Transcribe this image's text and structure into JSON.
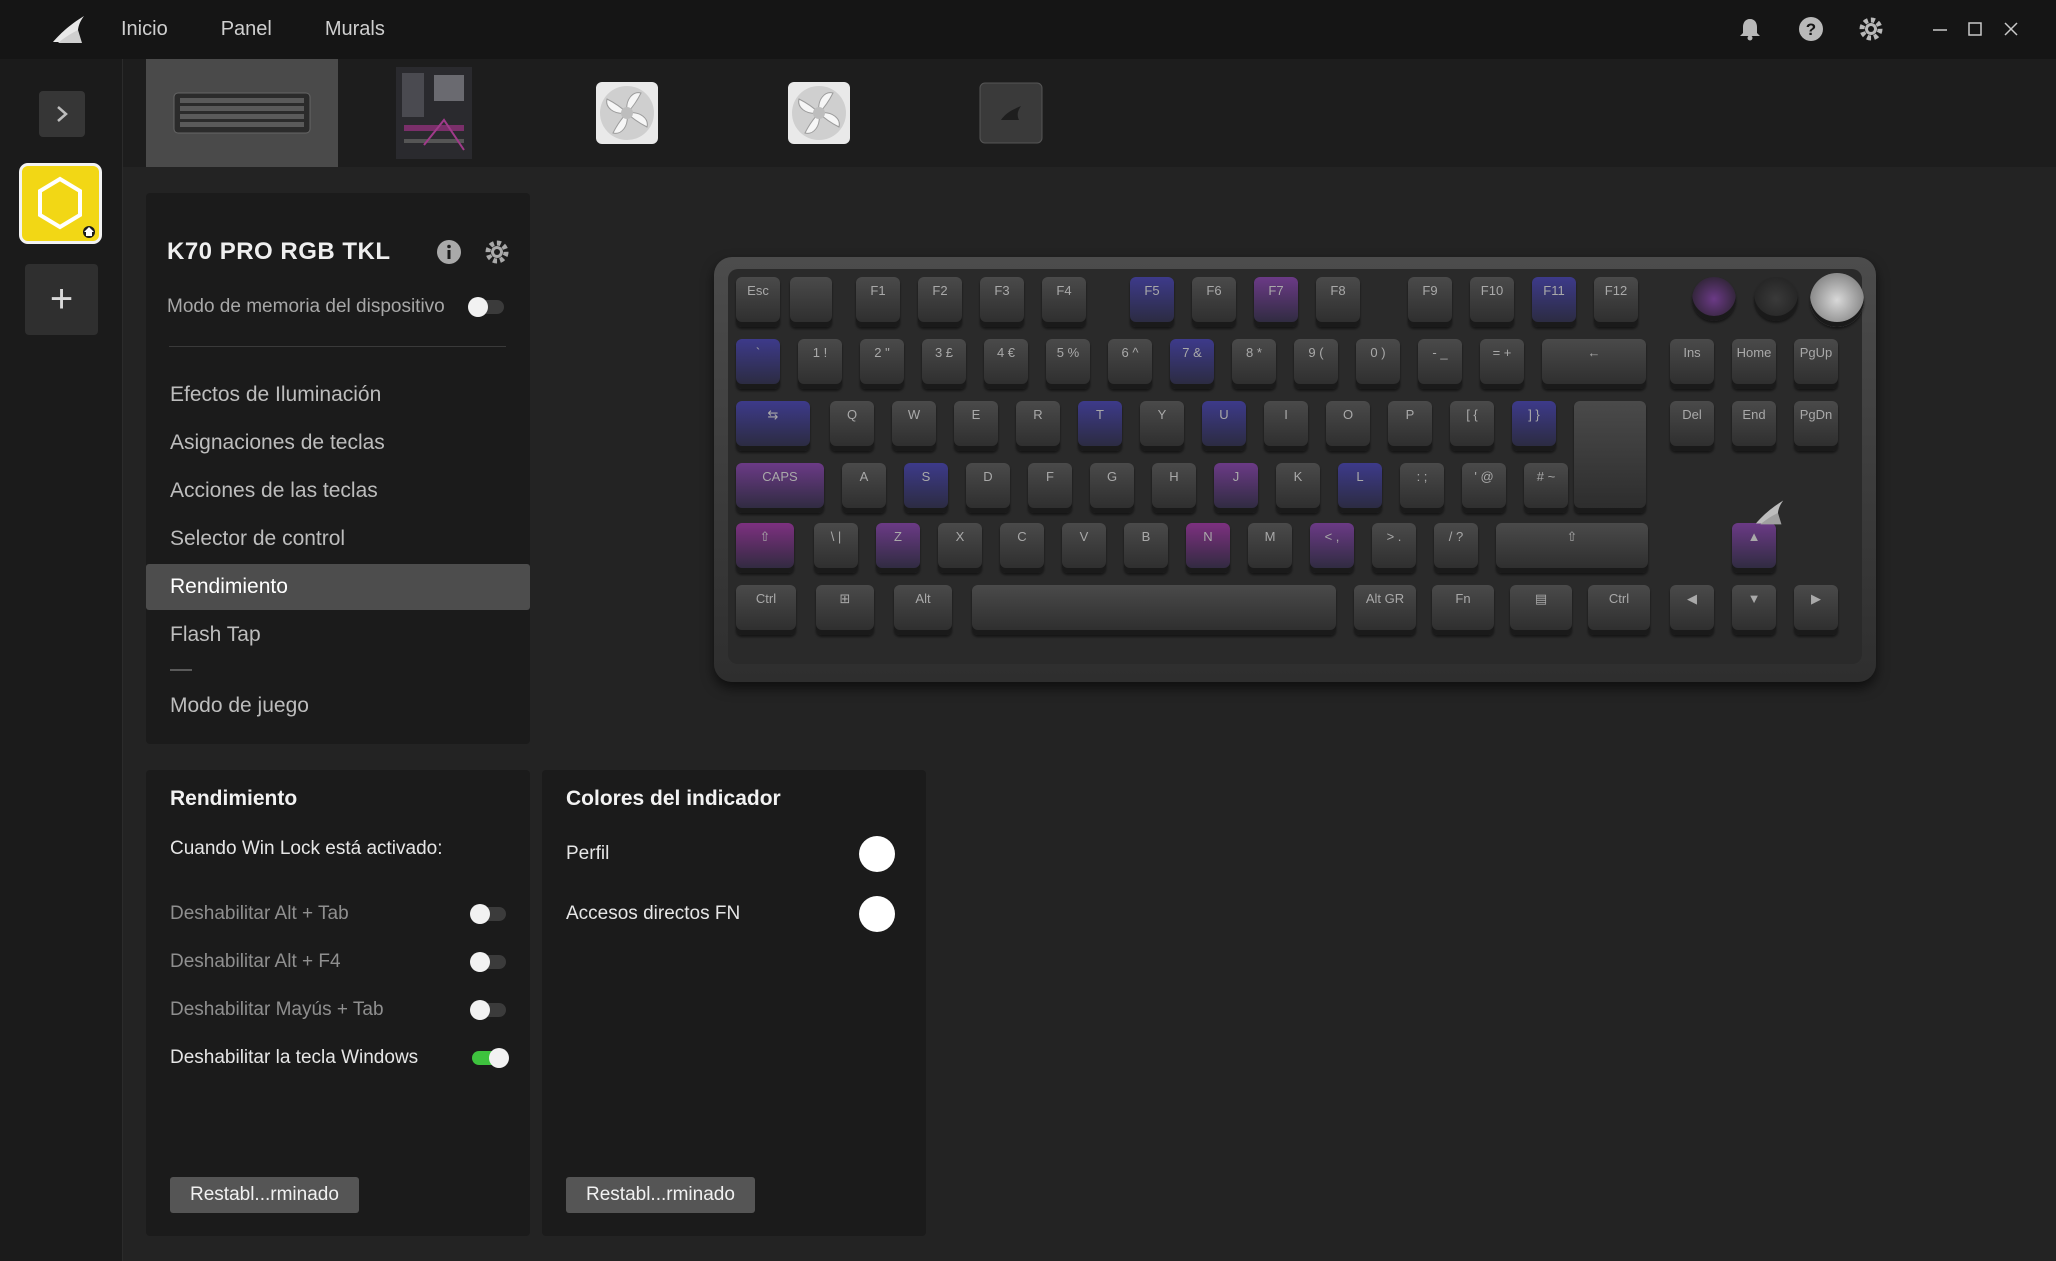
{
  "nav": {
    "items": [
      "Inicio",
      "Panel",
      "Murals"
    ]
  },
  "device": {
    "name": "K70 PRO RGB TKL",
    "memory_mode_label": "Modo de memoria del dispositivo",
    "memory_mode_on": false
  },
  "menu": {
    "items": [
      "Efectos de Iluminación",
      "Asignaciones de teclas",
      "Acciones de las teclas",
      "Selector de control",
      "Rendimiento",
      "Flash Tap"
    ],
    "game_mode": "Modo de juego",
    "active": "Rendimiento"
  },
  "performance": {
    "title": "Rendimiento",
    "subtitle": "Cuando Win Lock está activado:",
    "options": [
      {
        "label": "Deshabilitar Alt + Tab",
        "on": false
      },
      {
        "label": "Deshabilitar Alt + F4",
        "on": false
      },
      {
        "label": "Deshabilitar Mayús + Tab",
        "on": false
      },
      {
        "label": "Deshabilitar la tecla Windows",
        "on": true
      }
    ],
    "reset_label": "Restabl...rminado"
  },
  "indicator": {
    "title": "Colores del indicador",
    "rows": [
      {
        "label": "Perfil",
        "color": "#ffffff"
      },
      {
        "label": "Accesos directos FN",
        "color": "#ffffff"
      }
    ],
    "reset_label": "Restabl...rminado"
  },
  "keyboard": {
    "rows": [
      [
        "Esc",
        "",
        "F1",
        "F2",
        "F3",
        "F4",
        "F5",
        "F6",
        "F7",
        "F8",
        "F9",
        "F10",
        "F11",
        "F12"
      ],
      [
        "`",
        "1 !",
        "2 \"",
        "3 £",
        "4 €",
        "5 %",
        "6 ^",
        "7 &",
        "8 *",
        "9 (",
        "0 )",
        "- _",
        "= +",
        "←",
        "Ins",
        "Home",
        "PgUp"
      ],
      [
        "⇆",
        "Q",
        "W",
        "E",
        "R",
        "T",
        "Y",
        "U",
        "I",
        "O",
        "P",
        "[ {",
        "] }",
        "Del",
        "End",
        "PgDn"
      ],
      [
        "CAPS",
        "A",
        "S",
        "D",
        "F",
        "G",
        "H",
        "J",
        "K",
        "L",
        ": ;",
        "' @",
        "# ~"
      ],
      [
        "⇧",
        "\\ |",
        "Z",
        "X",
        "C",
        "V",
        "B",
        "N",
        "M",
        "< ,",
        "> .",
        "/ ?",
        "⇧",
        "▲"
      ],
      [
        "Ctrl",
        "⊞",
        "Alt",
        "",
        "Alt GR",
        "Fn",
        "▤",
        "Ctrl",
        "◀",
        "▼",
        "▶"
      ]
    ]
  },
  "colors": {
    "profile_tile": "#f2d715",
    "toggle_on": "#3ec23e",
    "key_blue": "#3d3a8a",
    "key_purple": "#6b3a86",
    "key_magenta": "#7d3080"
  }
}
